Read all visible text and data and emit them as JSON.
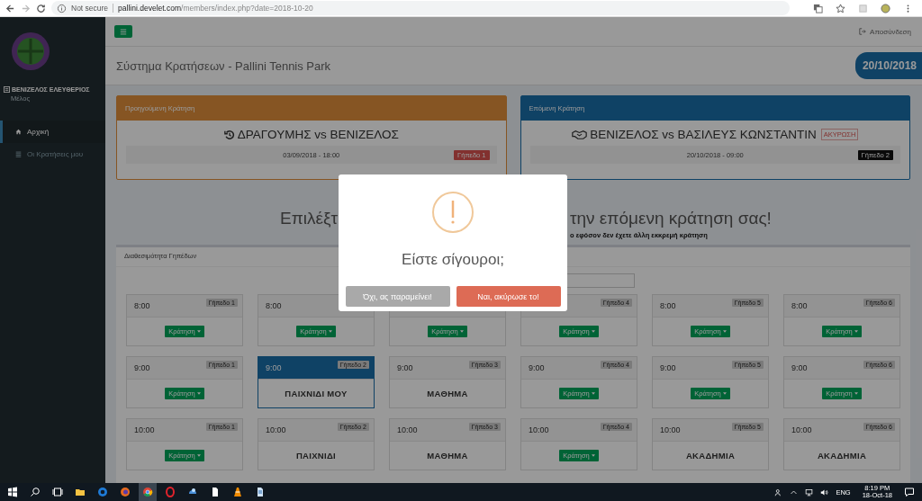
{
  "browser": {
    "security": "Not secure",
    "url_host": "pallini.develet.com",
    "url_path": "/members/index.php?date=2018-10-20"
  },
  "sidebar": {
    "user": "ΒΕΝΙΖΕΛΟΣ ΕΛΕΥΘΕΡΙΟΣ",
    "role": "Μέλος",
    "items": [
      {
        "label": "Αρχική",
        "selected": true
      },
      {
        "label": "Οι Κρατήσεις μου",
        "selected": false
      }
    ]
  },
  "topbar": {
    "logout": "Αποσύνδεση"
  },
  "header": {
    "title": "Σύστημα Κρατήσεων - Pallini Tennis Park",
    "date": "20/10/2018"
  },
  "cards": [
    {
      "kind": "previous",
      "heading": "Προηγούμενη Κράτηση",
      "match": "ΔΡΑΓΟΥΜΗΣ vs ΒΕΝΙΖΕΛΟΣ",
      "when": "03/09/2018  -  18:00",
      "court": "Γήπεδο 1"
    },
    {
      "kind": "next",
      "heading": "Επόμενη Κράτηση",
      "match": "ΒΕΝΙΖΕΛΟΣ vs ΒΑΣΙΛΕΥΣ ΚΩΝΣΤΑΝΤΙΝ",
      "cancel": "ΑΚΥΡΩΣΗ",
      "when": "20/10/2018  -  09:00",
      "court": "Γήπεδο 2"
    }
  ],
  "headline": {
    "left": "Επιλέξτ",
    "right": "την επόμενη κράτηση σας!",
    "note": "ο εφόσον δεν έχετε άλλη εκκρεμή κράτηση"
  },
  "availability": {
    "title": "Διαθεσιμότητα Γηπέδων",
    "rows": [
      {
        "cells": [
          {
            "time": "8:00",
            "court": "Γήπεδο 1",
            "kind": "free",
            "button": "Κράτηση",
            "selected": false
          },
          {
            "time": "8:00",
            "kind": "free",
            "button": "Κράτηση",
            "selected": false
          },
          {
            "kind": "free",
            "button": "Κράτηση",
            "selected": false
          },
          {
            "court": "Γήπεδο 4",
            "kind": "free",
            "button": "Κράτηση",
            "selected": false
          },
          {
            "time": "8:00",
            "court": "Γήπεδο 5",
            "kind": "free",
            "button": "Κράτηση",
            "selected": false
          },
          {
            "time": "8:00",
            "court": "Γήπεδο 6",
            "kind": "free",
            "button": "Κράτηση",
            "selected": false
          }
        ]
      },
      {
        "cells": [
          {
            "time": "9:00",
            "court": "Γήπεδο 1",
            "kind": "free",
            "button": "Κράτηση",
            "selected": false
          },
          {
            "time": "9:00",
            "court": "Γήπεδο 2",
            "kind": "booked",
            "status": "ΠΑΙΧΝΙΔΙ ΜΟΥ",
            "selected": true
          },
          {
            "time": "9:00",
            "court": "Γήπεδο 3",
            "kind": "booked",
            "status": "ΜΑΘΗΜΑ",
            "selected": false
          },
          {
            "time": "9:00",
            "court": "Γήπεδο 4",
            "kind": "free",
            "button": "Κράτηση",
            "selected": false
          },
          {
            "time": "9:00",
            "court": "Γήπεδο 5",
            "kind": "free",
            "button": "Κράτηση",
            "selected": false
          },
          {
            "time": "9:00",
            "court": "Γήπεδο 6",
            "kind": "free",
            "button": "Κράτηση",
            "selected": false
          }
        ]
      },
      {
        "cells": [
          {
            "time": "10:00",
            "court": "Γήπεδο 1",
            "kind": "free",
            "button": "Κράτηση",
            "selected": false
          },
          {
            "time": "10:00",
            "court": "Γήπεδο 2",
            "kind": "booked",
            "status": "ΠΑΙΧΝΙΔΙ",
            "selected": false
          },
          {
            "time": "10:00",
            "court": "Γήπεδο 3",
            "kind": "booked",
            "status": "ΜΑΘΗΜΑ",
            "selected": false
          },
          {
            "time": "10:00",
            "court": "Γήπεδο 4",
            "kind": "free",
            "button": "Κράτηση",
            "selected": false
          },
          {
            "time": "10:00",
            "court": "Γήπεδο 5",
            "kind": "booked",
            "status": "ΑΚΑΔΗΜΙΑ",
            "selected": false
          },
          {
            "time": "10:00",
            "court": "Γήπεδο 6",
            "kind": "booked",
            "status": "ΑΚΑΔΗΜΙΑ",
            "selected": false
          }
        ]
      }
    ]
  },
  "dialog": {
    "title": "Είστε σίγουροι;",
    "buttons": [
      {
        "label": "Όχι, ας παραμείνει!",
        "kind": "cancel"
      },
      {
        "label": "Ναι, ακύρωσε το!",
        "kind": "confirm"
      }
    ]
  },
  "taskbar": {
    "language": "ENG",
    "time": "8:19 PM",
    "date": "18-Oct-18"
  }
}
